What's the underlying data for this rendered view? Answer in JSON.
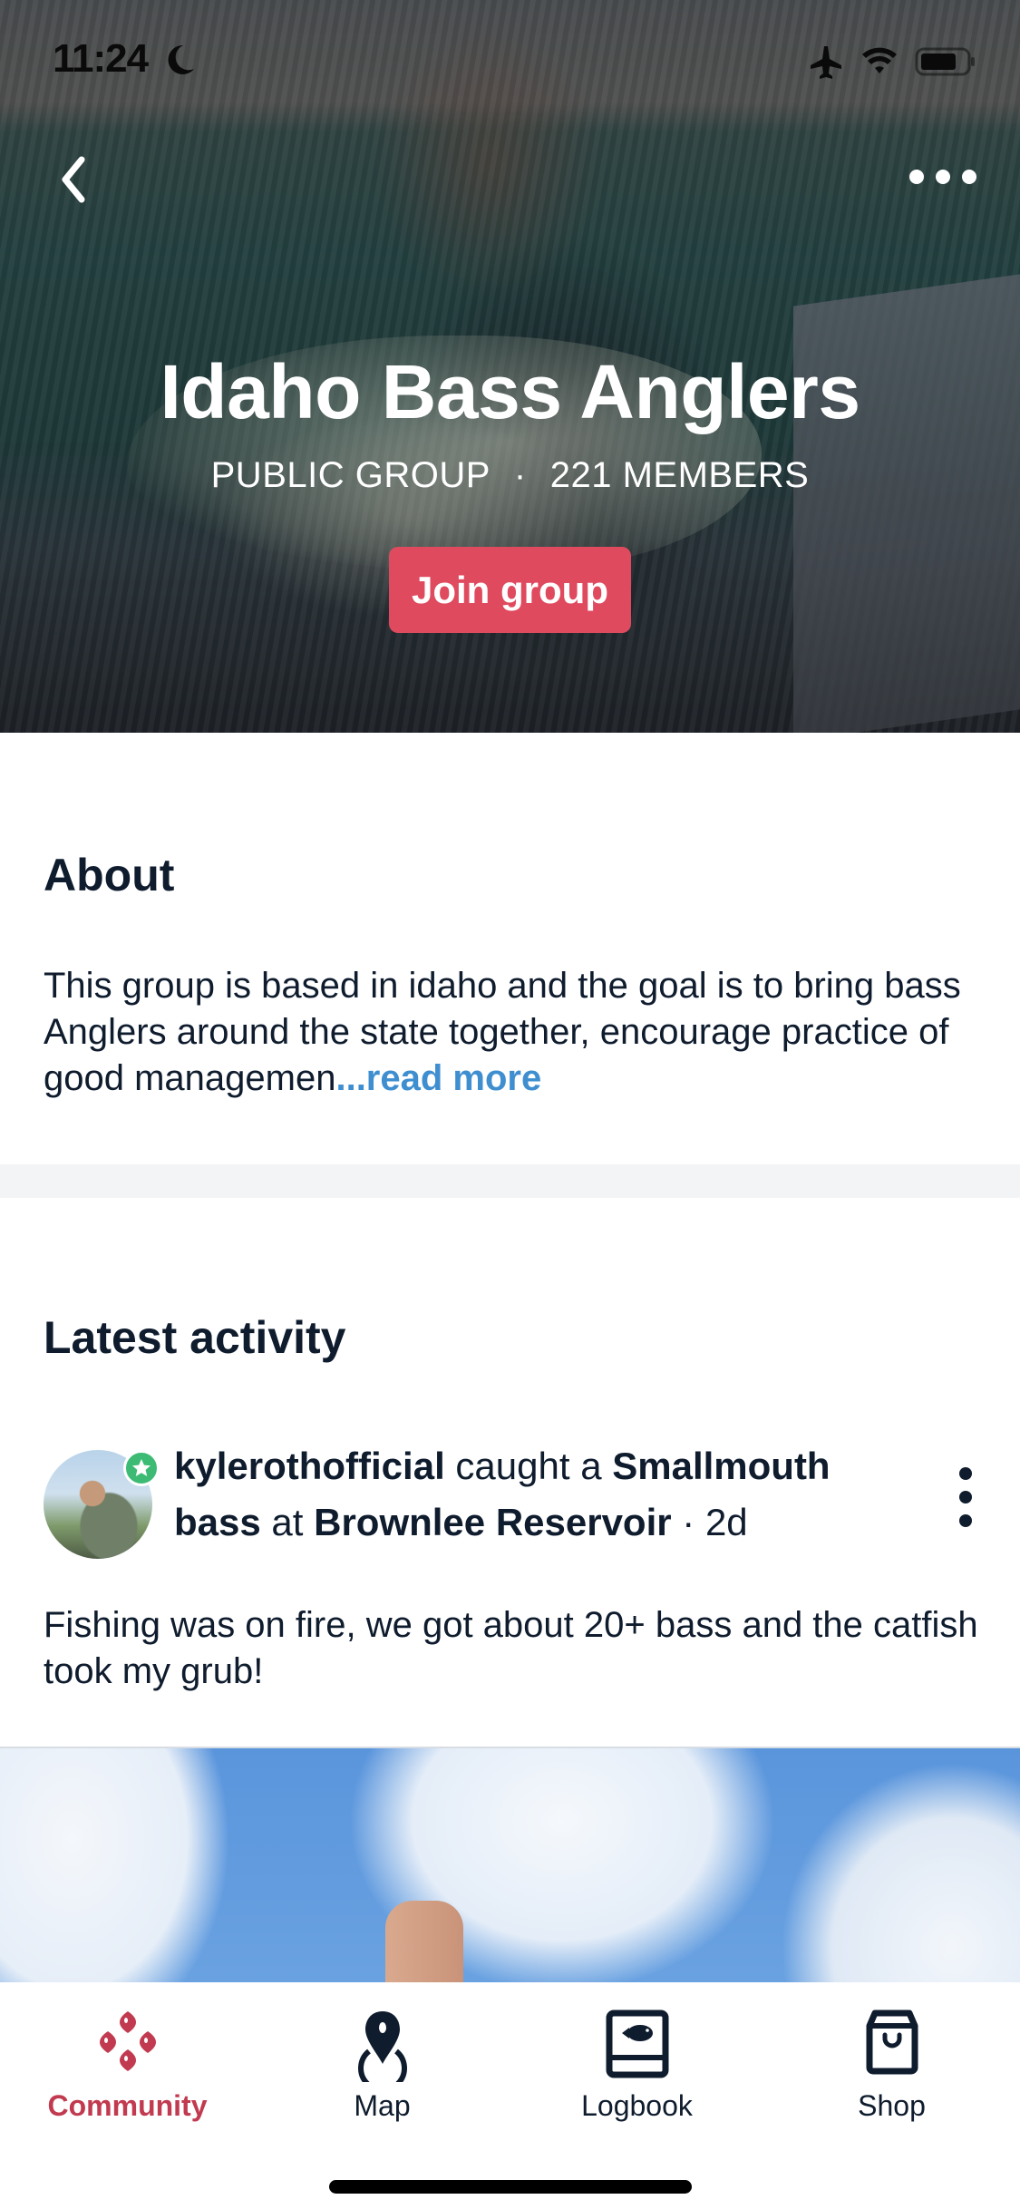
{
  "status_bar": {
    "time": "11:24",
    "icons": [
      "moon-icon",
      "airplane-icon",
      "wifi-icon",
      "battery-icon"
    ]
  },
  "header": {
    "back_icon": "chevron-left-icon",
    "more_icon": "more-horizontal-icon"
  },
  "group": {
    "title": "Idaho Bass Anglers",
    "privacy": "PUBLIC GROUP",
    "separator": "·",
    "members": "221 MEMBERS",
    "join_label": "Join group"
  },
  "about": {
    "heading": "About",
    "text": " This group is based in idaho and the goal is to bring bass Anglers around the state together, encourage practice of good managemen",
    "read_more": "...read more"
  },
  "activity": {
    "heading": "Latest activity",
    "posts": [
      {
        "username": "kylerothofficial",
        "verb": "caught a",
        "species_line1": "Smallmouth",
        "species_line2": "bass",
        "preposition": "at",
        "location": "Brownlee Reservoir",
        "separator": "·",
        "age": "2d",
        "body": "Fishing was on fire, we got about 20+ bass and the catfish took my grub!",
        "badge_icon": "star-badge-icon",
        "menu_icon": "more-vertical-icon"
      }
    ]
  },
  "tab_bar": {
    "active_color": "#c13a4f",
    "tabs": [
      {
        "label": "Community",
        "icon": "community-icon",
        "active": true
      },
      {
        "label": "Map",
        "icon": "map-pin-icon",
        "active": false
      },
      {
        "label": "Logbook",
        "icon": "logbook-icon",
        "active": false
      },
      {
        "label": "Shop",
        "icon": "shopping-bag-icon",
        "active": false
      }
    ]
  },
  "colors": {
    "join_button": "#df4a5f",
    "read_more": "#3e8ed0",
    "text_primary": "#0f1c2e",
    "verified_badge": "#3dbb74"
  }
}
